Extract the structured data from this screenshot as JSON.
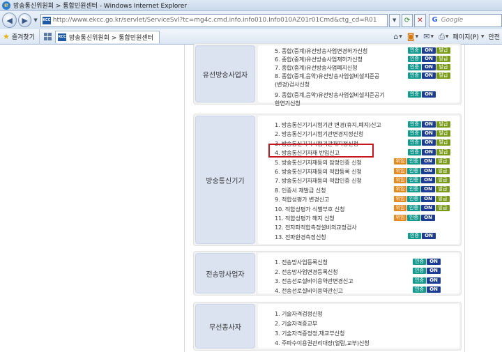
{
  "window": {
    "title": "방송통신위원회 > 통합민원센터 - Windows Internet Explorer"
  },
  "address_bar": {
    "url": "http://www.ekcc.go.kr/servlet/ServiceSvl?tc=mg4c.cmd.info.info010.Info010AZ01r01Cmd&ctg_cd=R01",
    "favicon_text": "KCC",
    "search_placeholder": "Google"
  },
  "favorites_bar": {
    "favorites_label": "즐겨찾기",
    "tab_title": "방송통신위원회 > 통합민원센터",
    "page_menu": "페이지(P)",
    "safety_menu": "안전"
  },
  "badge_labels": {
    "wi": "위임",
    "in": "인증",
    "on": "ON",
    "bal": "발급"
  },
  "sections": [
    {
      "label": "유선방송사업자",
      "items": [
        {
          "text": "5. 종합(중계)유선방송사업변경허가신청",
          "badges": [
            "in",
            "on",
            "bal"
          ]
        },
        {
          "text": "6. 종합(중계)유선방송사업재허가신청",
          "badges": [
            "in",
            "on",
            "bal"
          ]
        },
        {
          "text": "7. 종합(중계)유선방송사업폐지신청",
          "badges": [
            "in",
            "on",
            "bal"
          ]
        },
        {
          "text": "8. 종합(중계,음악)유선방송사업설비설치준공",
          "badges": [
            "in",
            "on",
            "bal"
          ]
        },
        {
          "text": "(변경)검사신청",
          "badges": []
        },
        {
          "text": "9. 종합(중계,음악)유선방송사업설비설치준공기",
          "badges": [
            "in",
            "on"
          ]
        },
        {
          "text": "한연기신청",
          "badges": []
        }
      ]
    },
    {
      "label": "방송통신기기",
      "items": [
        {
          "text": "1. 방송통신기기시험기관 변경(휴지,폐지)신고",
          "badges": [
            "in",
            "on",
            "bal"
          ]
        },
        {
          "text": "2. 방송통신기기시험기관변경지정신청",
          "badges": [
            "in",
            "on",
            "bal"
          ]
        },
        {
          "text": "3. 방송통신기기시험기관재지정신청",
          "badges": [
            "in",
            "on",
            "bal"
          ]
        },
        {
          "text": "4. 방송통신기자재 반입신고",
          "badges": [
            "in",
            "on",
            "bal"
          ]
        },
        {
          "text": "5. 방송통신기자재등의 잠정인증 신청",
          "badges": [
            "wi",
            "in",
            "on",
            "bal"
          ]
        },
        {
          "text": "6. 방송통신기자재등의 적합등록 신청",
          "badges": [
            "wi",
            "in",
            "on",
            "bal"
          ]
        },
        {
          "text": "7. 방송통신기자재등의 적합인증 신청",
          "badges": [
            "wi",
            "in",
            "on",
            "bal"
          ]
        },
        {
          "text": "8. 인증서 재발급 신청",
          "badges": [
            "wi",
            "in",
            "on",
            "bal"
          ]
        },
        {
          "text": "9. 적합성평가 변경신고",
          "badges": [
            "wi",
            "in",
            "on",
            "bal"
          ]
        },
        {
          "text": "10. 적합성평가 식별부호 신청",
          "badges": [
            "wi",
            "in",
            "on",
            "bal"
          ]
        },
        {
          "text": "11. 적합성평가 해지 신청",
          "badges": [
            "wi",
            "in",
            "on"
          ]
        },
        {
          "text": "12. 전자파적합측정설비의교정검사",
          "badges": []
        },
        {
          "text": "13. 전파환경측정신청",
          "badges": [
            "in",
            "on"
          ]
        }
      ]
    },
    {
      "label": "전송망사업자",
      "items": [
        {
          "text": "1. 전송망사업등록신청",
          "badges": [
            "in",
            "on"
          ]
        },
        {
          "text": "2. 전송망사업변경등록신청",
          "badges": [
            "in",
            "on"
          ]
        },
        {
          "text": "3. 전송선로설비이용약관변경신고",
          "badges": [
            "in",
            "on"
          ]
        },
        {
          "text": "4. 전송선로설비이용약관신고",
          "badges": [
            "in",
            "on"
          ]
        }
      ]
    },
    {
      "label": "무선종사자",
      "items": [
        {
          "text": "1. 기술자격검정신청",
          "badges": []
        },
        {
          "text": "2. 기술자격증교부",
          "badges": []
        },
        {
          "text": "3. 기술자격증정정,재교부신청",
          "badges": []
        },
        {
          "text": "4. 주파수이용권관리대장(열람,교부)신청",
          "badges": []
        }
      ]
    }
  ]
}
